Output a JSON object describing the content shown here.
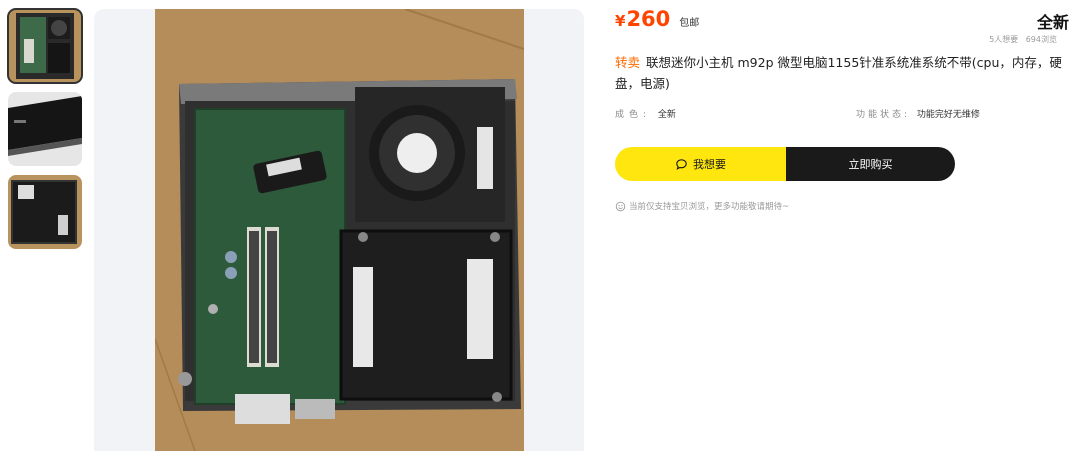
{
  "gallery": {
    "thumbnails": [
      "thumbnail-1",
      "thumbnail-2",
      "thumbnail-3"
    ],
    "active_index": 0
  },
  "product": {
    "price_symbol": "¥",
    "price": "260",
    "shipping": "包邮",
    "condition_badge": "全新",
    "want_count": "5人想要",
    "view_count": "694浏览",
    "tag": "转卖",
    "title": "联想迷你小主机 m92p 微型电脑1155针准系统准系统不带(cpu，内存，硬盘，电源)",
    "attrs": [
      {
        "key": "成色:",
        "value": "全新"
      },
      {
        "key": "功能状态:",
        "value": "功能完好无维修"
      }
    ]
  },
  "actions": {
    "want_label": "我想要",
    "buy_label": "立即购买"
  },
  "notice": "当前仅支持宝贝浏览，更多功能敬请期待~",
  "colors": {
    "price": "#ff4400",
    "tag": "#ff6a00",
    "want_button": "#ffe60f",
    "buy_button": "#1a1a1a"
  },
  "icons": {
    "want": "chat-bubble-icon",
    "notice": "smiley-icon"
  }
}
